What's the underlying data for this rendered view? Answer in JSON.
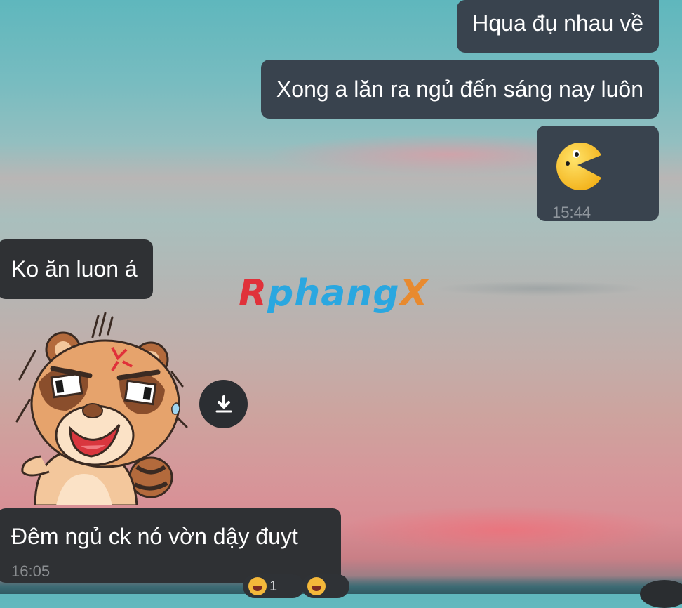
{
  "messages": {
    "sent1": "Hqua đụ nhau về",
    "sent2": "Xong a lăn ra ngủ đến sáng nay luôn",
    "sent3_time": "15:44",
    "recv1": "Ko ăn luon á",
    "recv2": "Đêm ngủ ck nó vờn dậy đuyt",
    "recv2_time": "16:05"
  },
  "watermark": {
    "part1": "R",
    "part2": "phang",
    "part3": "X"
  },
  "reactions": [
    {
      "icon": "laughing-crying-emoji",
      "count": "1"
    },
    {
      "icon": "laughing-crying-emoji"
    }
  ],
  "icons": {
    "pacman": "pacman-sticker-icon",
    "download": "download-icon",
    "sticker": "angry-raccoon-sticker"
  },
  "colors": {
    "sent_bubble": "#39434e",
    "received_bubble": "#2f3134",
    "timestamp": "#8f969d"
  }
}
